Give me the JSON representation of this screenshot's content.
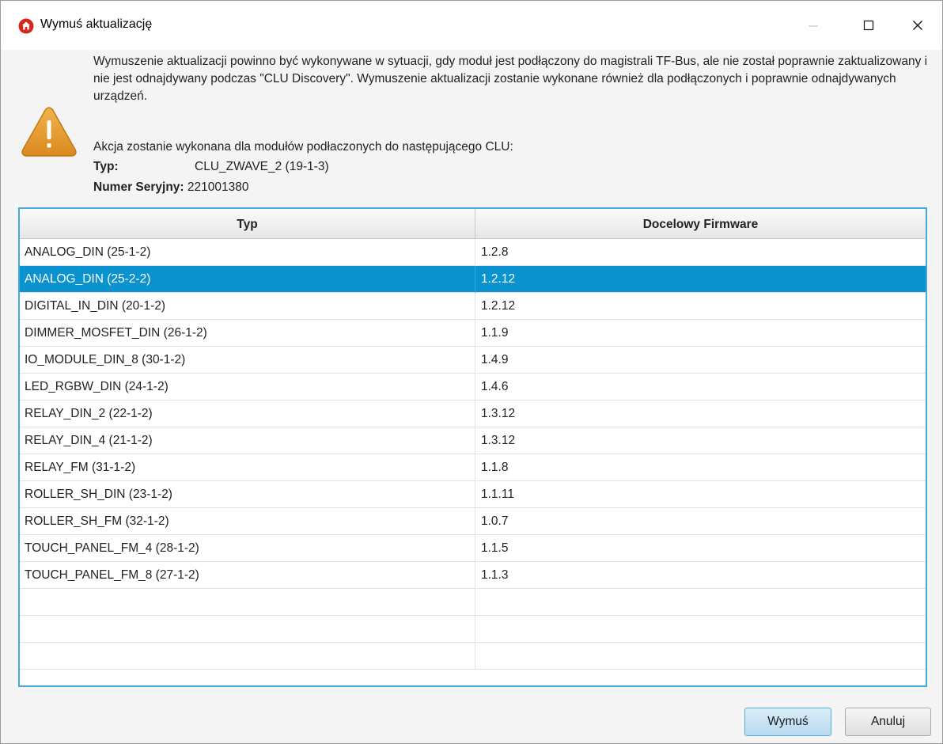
{
  "window": {
    "title": "Wymuś aktualizację"
  },
  "message": {
    "paragraph": "Wymuszenie aktualizacji powinno być wykonywane w sytuacji, gdy moduł jest podłączony do magistrali TF-Bus, ale nie został poprawnie zaktualizowany i nie jest odnajdywany podczas \"CLU Discovery\". Wymuszenie aktualizacji zostanie wykonane również dla podłączonych i poprawnie odnajdywanych urządzeń.",
    "action": "Akcja zostanie wykonana dla modułów podłaczonych do następującego CLU:",
    "type_label": "Typ:",
    "type_value": "CLU_ZWAVE_2 (19-1-3)",
    "serial_label": "Numer Seryjny:",
    "serial_value": "221001380"
  },
  "table": {
    "columns": [
      "Typ",
      "Docelowy Firmware"
    ],
    "rows": [
      {
        "type": "ANALOG_DIN (25-1-2)",
        "firmware": "1.2.8"
      },
      {
        "type": "ANALOG_DIN (25-2-2)",
        "firmware": "1.2.12"
      },
      {
        "type": "DIGITAL_IN_DIN (20-1-2)",
        "firmware": "1.2.12"
      },
      {
        "type": "DIMMER_MOSFET_DIN (26-1-2)",
        "firmware": "1.1.9"
      },
      {
        "type": "IO_MODULE_DIN_8 (30-1-2)",
        "firmware": "1.4.9"
      },
      {
        "type": "LED_RGBW_DIN (24-1-2)",
        "firmware": "1.4.6"
      },
      {
        "type": "RELAY_DIN_2 (22-1-2)",
        "firmware": "1.3.12"
      },
      {
        "type": "RELAY_DIN_4 (21-1-2)",
        "firmware": "1.3.12"
      },
      {
        "type": "RELAY_FM (31-1-2)",
        "firmware": "1.1.8"
      },
      {
        "type": "ROLLER_SH_DIN (23-1-2)",
        "firmware": "1.1.11"
      },
      {
        "type": "ROLLER_SH_FM (32-1-2)",
        "firmware": "1.0.7"
      },
      {
        "type": "TOUCH_PANEL_FM_4 (28-1-2)",
        "firmware": "1.1.5"
      },
      {
        "type": "TOUCH_PANEL_FM_8 (27-1-2)",
        "firmware": "1.1.3"
      }
    ],
    "selected_index": 1,
    "empty_rows": 3
  },
  "buttons": {
    "ok": "Wymuś",
    "cancel": "Anuluj"
  },
  "colors": {
    "selection": "#0a93cf",
    "focus_border": "#45a8dd",
    "warning": "#e3a03a",
    "app_icon": "#d4281c"
  },
  "icons": {
    "app": "app-home-icon",
    "warning": "warning-icon",
    "minimize": "minimize-icon",
    "maximize": "maximize-icon",
    "close": "close-icon"
  }
}
